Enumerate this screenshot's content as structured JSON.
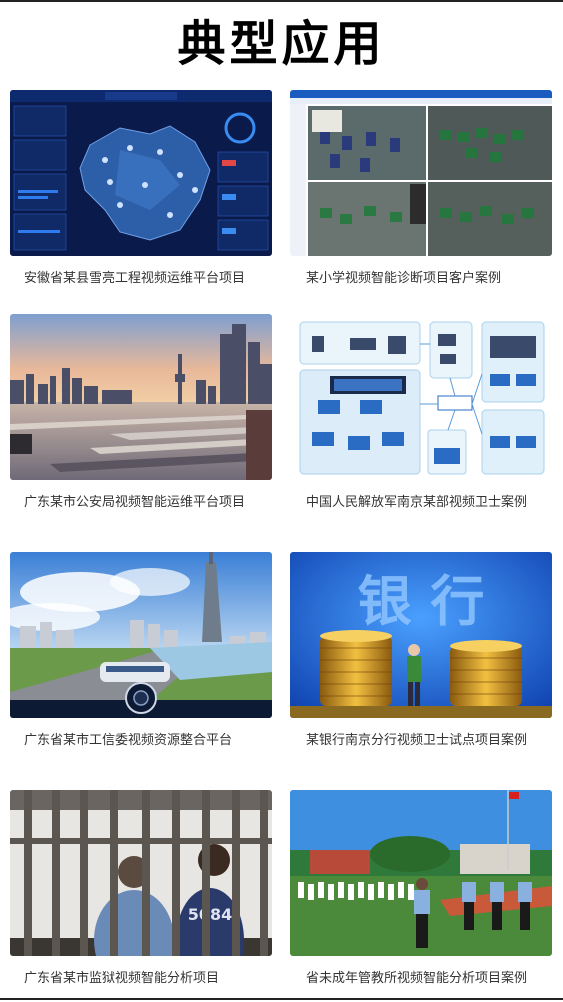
{
  "page": {
    "title": "典型应用"
  },
  "cards": [
    {
      "caption": "安徽省某县雪亮工程视频运维平台项目",
      "image": "dashboard-map-screenshot"
    },
    {
      "caption": "某小学视频智能诊断项目客户案例",
      "image": "classroom-surveillance-grid"
    },
    {
      "caption": "广东某市公安局视频智能运维平台项目",
      "image": "city-waterfront-skyline"
    },
    {
      "caption": "中国人民解放军南京某部视频卫士案例",
      "image": "network-topology-diagram"
    },
    {
      "caption": "广东省某市工信委视频资源整合平台",
      "image": "city-tower-tram"
    },
    {
      "caption": "某银行南京分行视频卫士试点项目案例",
      "image": "bank-gold-coins"
    },
    {
      "caption": "广东省某市监狱视频智能分析项目",
      "image": "prison-bars"
    },
    {
      "caption": "省未成年管教所视频智能分析项目案例",
      "image": "outdoor-exercise-yard"
    }
  ],
  "images": {
    "bank_chars": "银  行"
  }
}
